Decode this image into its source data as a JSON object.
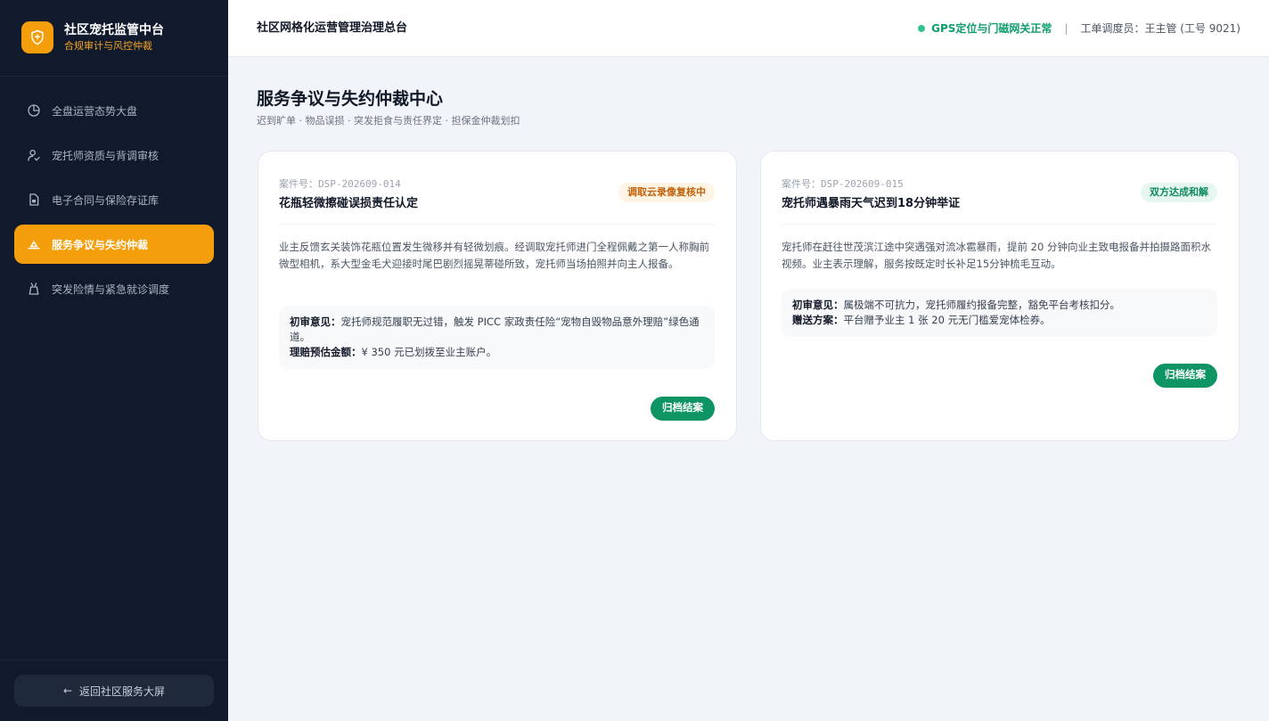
{
  "brand": {
    "title": "社区宠托监管中台",
    "subtitle": "合规审计与风控仲裁",
    "logo_icon": "shield-icon",
    "accent_color": "#f59e0b"
  },
  "sidebar": {
    "items": [
      {
        "label": "全盘运营态势大盘",
        "icon": "pie-chart-icon",
        "active": false
      },
      {
        "label": "宠托师资质与背调审核",
        "icon": "user-check-icon",
        "active": false
      },
      {
        "label": "电子合同与保险存证库",
        "icon": "document-icon",
        "active": false
      },
      {
        "label": "服务争议与失约仲裁",
        "icon": "gavel-icon",
        "active": true
      },
      {
        "label": "突发险情与紧急就诊调度",
        "icon": "alert-icon",
        "active": false
      }
    ],
    "back_label": "返回社区服务大屏"
  },
  "header": {
    "title": "社区网格化运营管理治理总台",
    "status_text": "GPS定位与门磁网关正常",
    "separator": "|",
    "operator": "工单调度员：王主管 (工号 9021)"
  },
  "main": {
    "title": "服务争议与失约仲裁中心",
    "subtitle": "迟到旷单 · 物品误损 · 突发拒食与责任界定 · 担保金仲裁划扣",
    "cards": [
      {
        "case_id": "案件号：DSP-202609-014",
        "title": "花瓶轻微擦碰误损责任认定",
        "badge": "调取云录像复核中",
        "description": "业主反馈玄关装饰花瓶位置发生微移并有轻微划痕。经调取宠托师进门全程佩戴之第一人称胸前微型相机，系大型金毛犬迎接时尾巴剧烈摇晃蒂碰所致，宠托师当场拍照并向主人报备。",
        "opinion_label": "初审意见：",
        "opinion_text": "宠托师规范履职无过错，触发 PICC 家政责任险“宠物自毁物品意外理赔”绿色通道。",
        "extra_label": "理赔预估金额：",
        "extra_text": "¥ 350 元已划拨至业主账户。",
        "button": "归档结案"
      },
      {
        "case_id": "案件号：DSP-202609-015",
        "title": "宠托师遇暴雨天气迟到18分钟举证",
        "badge": "双方达成和解",
        "description": "宠托师在赶往世茂滨江途中突遇强对流冰雹暴雨，提前 20 分钟向业主致电报备并拍摄路面积水视频。业主表示理解，服务按既定时长补足15分钟梳毛互动。",
        "opinion_label": "初审意见：",
        "opinion_text": "属极端不可抗力，宠托师履约报备完整，豁免平台考核扣分。",
        "extra_label": "赠送方案：",
        "extra_text": "平台赠予业主 1 张 20 元无门槛爱宠体检券。",
        "button": "归档结案"
      }
    ]
  }
}
